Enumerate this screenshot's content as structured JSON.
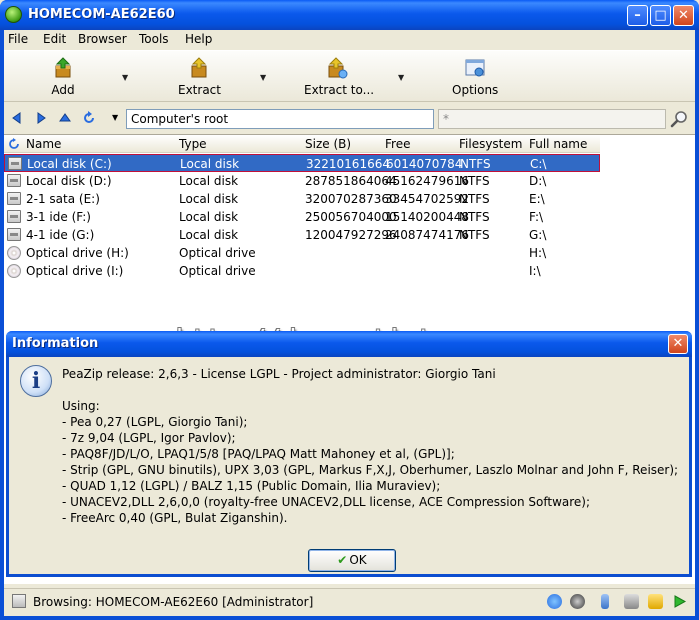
{
  "window": {
    "title": "HOMECOM-AE62E60"
  },
  "menu": [
    "File",
    "Edit",
    "Browser",
    "Tools",
    "Help"
  ],
  "toolbar": {
    "add": "Add",
    "extract": "Extract",
    "extract_to": "Extract to...",
    "options": "Options"
  },
  "address": {
    "path": "Computer's root",
    "search_value": "*"
  },
  "columns": [
    "Name",
    "Type",
    "Size (B)",
    "Free",
    "Filesystem",
    "Full name"
  ],
  "rows": [
    {
      "name": "Local disk (C:)",
      "type": "Local disk",
      "size": "32210161664",
      "free": "6014070784",
      "fs": "NTFS",
      "full": "C:\\",
      "kind": "disk"
    },
    {
      "name": "Local disk (D:)",
      "type": "Local disk",
      "size": "287851864064",
      "free": "45162479616",
      "fs": "NTFS",
      "full": "D:\\",
      "kind": "disk"
    },
    {
      "name": "2-1 sata (E:)",
      "type": "Local disk",
      "size": "320070287360",
      "free": "33454702592",
      "fs": "NTFS",
      "full": "E:\\",
      "kind": "disk"
    },
    {
      "name": "3-1 ide (F:)",
      "type": "Local disk",
      "size": "250056704000",
      "free": "15140200448",
      "fs": "NTFS",
      "full": "F:\\",
      "kind": "disk"
    },
    {
      "name": "4-1 ide (G:)",
      "type": "Local disk",
      "size": "120047927296",
      "free": "24087474176",
      "fs": "NTFS",
      "full": "G:\\",
      "kind": "disk"
    },
    {
      "name": "Optical drive (H:)",
      "type": "Optical drive",
      "size": "",
      "free": "",
      "fs": "",
      "full": "H:\\",
      "kind": "cd"
    },
    {
      "name": "Optical drive (I:)",
      "type": "Optical drive",
      "size": "",
      "free": "",
      "fs": "",
      "full": "I:\\",
      "kind": "cd"
    }
  ],
  "watermark": "http://demun.tistory.com",
  "dialog": {
    "title": "Information",
    "lines": [
      "PeaZip release: 2,6,3 - License LGPL - Project administrator: Giorgio Tani",
      "Using:",
      " - Pea 0,27 (LGPL, Giorgio Tani);",
      " - 7z 9,04 (LGPL, Igor Pavlov);",
      " - PAQ8F/JD/L/O, LPAQ1/5/8 [PAQ/LPAQ Matt Mahoney et al, (GPL)];",
      " - Strip (GPL, GNU binutils), UPX 3,03 (GPL, Markus F,X,J, Oberhumer, Laszlo Molnar and John F, Reiser);",
      " - QUAD 1,12 (LGPL) / BALZ 1,15 (Public Domain, Ilia Muraviev);",
      " - UNACEV2,DLL 2,6,0,0 (royalty-free UNACEV2,DLL license, ACE Compression Software);",
      " - FreeArc 0,40 (GPL, Bulat Ziganshin)."
    ],
    "ok_label": "OK"
  },
  "status": {
    "text": "Browsing: HOMECOM-AE62E60 [Administrator]"
  }
}
